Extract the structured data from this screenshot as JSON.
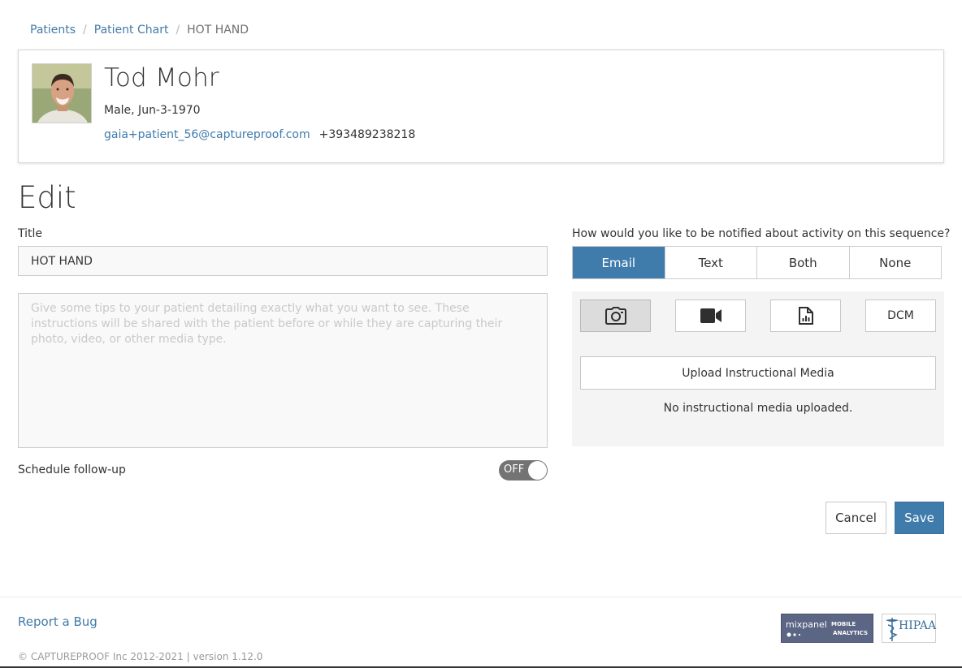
{
  "breadcrumb": {
    "patients": "Patients",
    "separator": "/",
    "patient_chart": "Patient Chart",
    "current": "HOT HAND"
  },
  "patient": {
    "name": "Tod Mohr",
    "meta": "Male, Jun-3-1970",
    "email": "gaia+patient_56@captureproof.com",
    "phone": "+393489238218"
  },
  "edit": {
    "heading": "Edit",
    "title_label": "Title",
    "title_value": "HOT HAND",
    "instructions_placeholder": "Give some tips to your patient detailing exactly what you want to see. These instructions will be shared with the patient before or while they are capturing their photo, video, or other media type.",
    "schedule_label": "Schedule follow-up",
    "schedule_toggle": "OFF"
  },
  "notify": {
    "question": "How would you like to be notified about activity on this sequence?",
    "options": [
      "Email",
      "Text",
      "Both",
      "None"
    ],
    "selected": "Email"
  },
  "media": {
    "types": [
      {
        "icon": "camera-icon",
        "label": ""
      },
      {
        "icon": "video-camera-icon",
        "label": ""
      },
      {
        "icon": "document-chart-icon",
        "label": ""
      },
      {
        "icon": "",
        "label": "DCM"
      }
    ],
    "selected": "camera-icon",
    "upload_label": "Upload Instructional Media",
    "empty_text": "No instructional media uploaded."
  },
  "actions": {
    "cancel": "Cancel",
    "save": "Save"
  },
  "footer": {
    "report_bug": "Report a Bug",
    "copyright": "© CAPTUREPROOF Inc 2012-2021 | version 1.12.0",
    "mixpanel_brand": "mixpanel",
    "mixpanel_mobile": "MOBILE",
    "mixpanel_analytics": "ANALYTICS",
    "hipaa": "HIPAA"
  },
  "colors": {
    "accent": "#3f7bab",
    "toggle_off": "#737373",
    "media_panel_bg": "#f4f4f4"
  }
}
